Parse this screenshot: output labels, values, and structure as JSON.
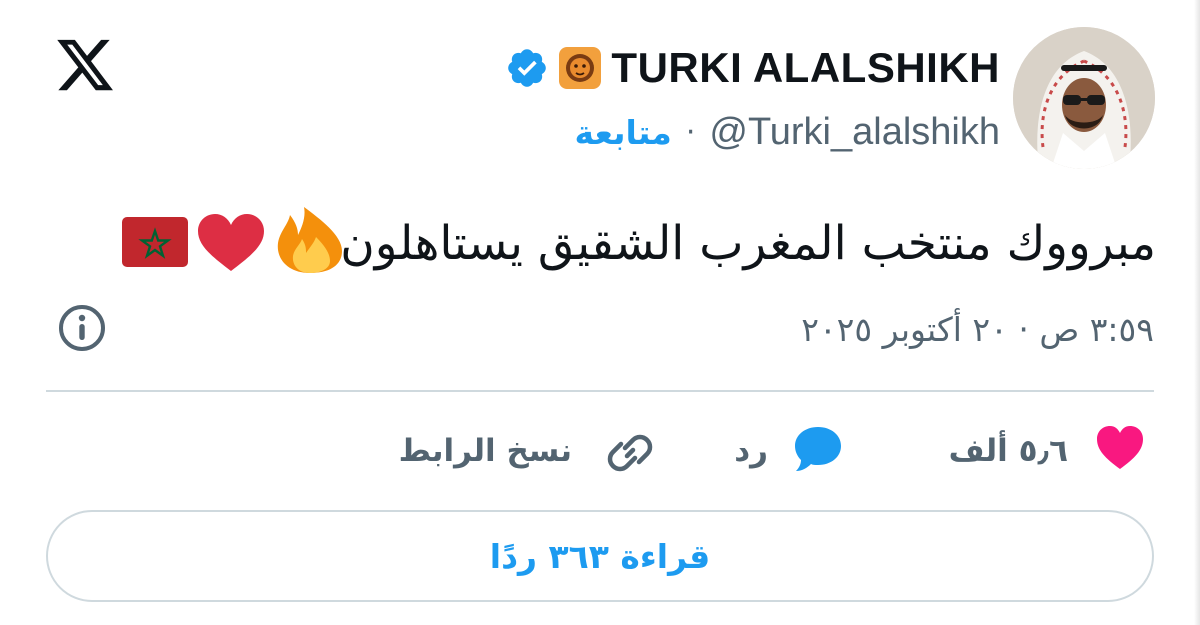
{
  "header": {
    "display_name": "TURKI ALALSHIKH",
    "handle": "@Turki_alalshikh",
    "separator": "·",
    "follow_label": "متابعة",
    "avatar": "profile-photo"
  },
  "tweet": {
    "text": "مبرووك منتخب المغرب الشقيق يستاهلون",
    "emojis": [
      "fire-emoji",
      "red-heart-emoji",
      "morocco-flag-emoji"
    ],
    "timestamp": "٣:٥٩ ص · ٢٠ أكتوبر ٢٠٢٥"
  },
  "actions": {
    "like_count": "٥٫٦ ألف",
    "reply_label": "رد",
    "copy_link_label": "نسخ الرابط"
  },
  "read_replies_label": "قراءة ٣٦٣ ردًا",
  "colors": {
    "accent": "#1d9bf0",
    "text": "#0f1419",
    "muted": "#536471",
    "like": "#f91880",
    "border": "#cfd9de"
  },
  "icons": {
    "logo": "x-logo-icon",
    "verified": "verified-badge-icon",
    "affiliate": "lion-badge-icon",
    "info": "info-icon",
    "like": "heart-icon",
    "reply": "speech-bubble-icon",
    "link": "link-icon"
  }
}
